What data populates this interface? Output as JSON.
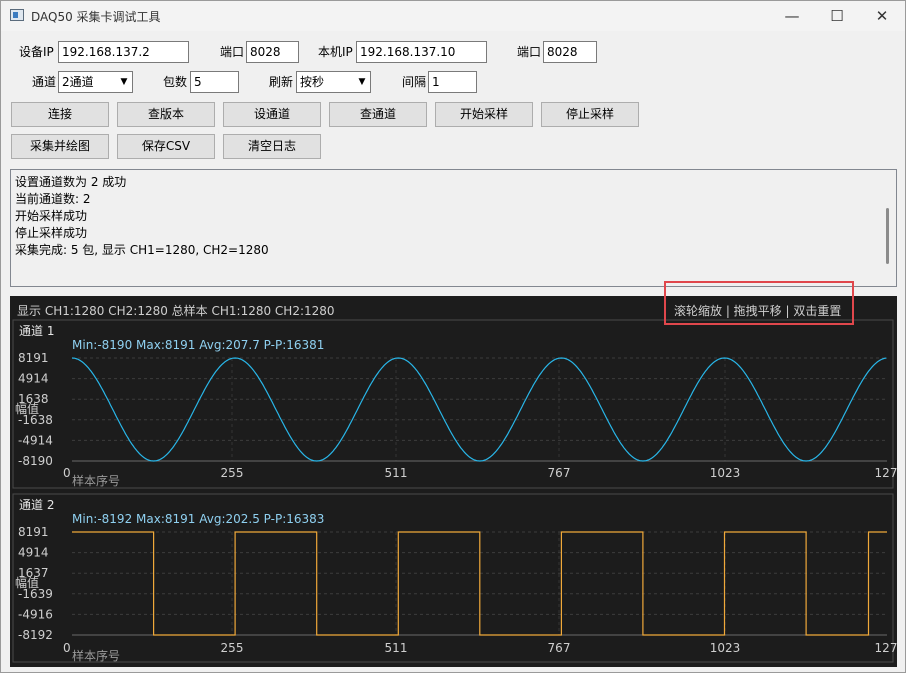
{
  "window": {
    "title": "DAQ50 采集卡调试工具",
    "minimize_glyph": "—",
    "maximize_glyph": "☐",
    "close_glyph": "✕"
  },
  "config": {
    "device_ip_label": "设备IP",
    "device_ip": "192.168.137.2",
    "device_port_label": "端口",
    "device_port": "8028",
    "local_ip_label": "本机IP",
    "local_ip": "192.168.137.10",
    "local_port_label": "端口",
    "local_port": "8028",
    "channel_label": "通道",
    "channel_value": "2通道",
    "packets_label": "包数",
    "packets_value": "5",
    "refresh_label": "刷新",
    "refresh_value": "按秒",
    "interval_label": "间隔",
    "interval_value": "1"
  },
  "buttons": {
    "connect": "连接",
    "query_version": "查版本",
    "set_channel": "设通道",
    "query_channel": "查通道",
    "start_sampling": "开始采样",
    "stop_sampling": "停止采样",
    "sample_and_plot": "采集并绘图",
    "save_csv": "保存CSV",
    "clear_log": "清空日志"
  },
  "log_lines": [
    "设置通道数为 2 成功",
    "当前通道数: 2",
    "开始采样成功",
    "停止采样成功",
    "采集完成: 5 包, 显示 CH1=1280, CH2=1280"
  ],
  "plot": {
    "header_status": "显示 CH1:1280  CH2:1280  总样本 CH1:1280  CH2:1280",
    "hint": "滚轮缩放 | 拖拽平移 | 双击重置"
  },
  "chart_data": [
    {
      "type": "line",
      "title": "通道 1",
      "stats": "Min:-8190   Max:8191   Avg:207.7   P-P:16381",
      "xlabel": "样本序号",
      "ylabel": "幅值",
      "x_ticks": [
        "0",
        "255",
        "511",
        "767",
        "1023",
        "127"
      ],
      "y_ticks": [
        "8191",
        "4914",
        "1638",
        "-1638",
        "-4914",
        "-8190"
      ],
      "xlim": [
        0,
        1279
      ],
      "ylim": [
        -8190,
        8191
      ],
      "color": "#29b6e8",
      "series": [
        {
          "waveform": "sine",
          "cycles": 5,
          "phase_deg": 180,
          "amplitude": 8190.5,
          "offset": 0.5
        }
      ]
    },
    {
      "type": "line",
      "title": "通道 2",
      "stats": "Min:-8192   Max:8191   Avg:202.5   P-P:16383",
      "xlabel": "样本序号",
      "ylabel": "幅值",
      "x_ticks": [
        "0",
        "255",
        "511",
        "767",
        "1023",
        "127"
      ],
      "y_ticks": [
        "8191",
        "4914",
        "1637",
        "-1639",
        "-4916",
        "-8192"
      ],
      "xlim": [
        0,
        1279
      ],
      "ylim": [
        -8192,
        8191
      ],
      "color": "#f0a93a",
      "series": [
        {
          "waveform": "square",
          "cycles": 5,
          "high": 8191,
          "low": -8192,
          "duty": 0.5
        }
      ]
    }
  ],
  "colors": {
    "plot_bg": "#1c1c1c",
    "ch1": "#29b6e8",
    "ch2": "#f0a93a",
    "highlight": "#e0474c"
  }
}
